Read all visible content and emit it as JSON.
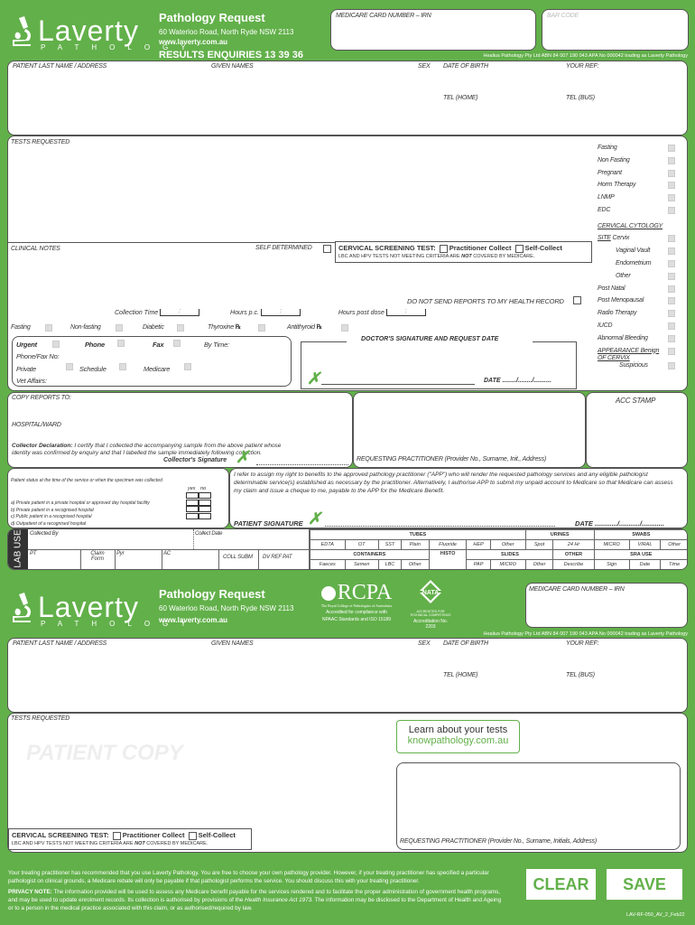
{
  "header": {
    "brand": "Laverty",
    "brand_sub": "PATHOLOGY",
    "title": "Pathology Request",
    "address": "60 Waterloo Road, North Ryde NSW 2113",
    "website": "www.laverty.com.au",
    "results": "RESULTS ENQUIRIES 13 39 36",
    "medicare_label": "MEDICARE CARD NUMBER – IRN",
    "barcode_label": "BAR CODE",
    "abn": "Healius Pathology Pty Ltd ABN 84 007 190 043 APA No 000042 trading as Laverty Pathology"
  },
  "patient": {
    "last_name": "PATIENT LAST NAME / ADDRESS",
    "given_names": "GIVEN NAMES",
    "sex": "SEX",
    "dob": "DATE OF BIRTH",
    "your_ref": "YOUR REF:",
    "tel_home": "TEL (HOME)",
    "tel_bus": "TEL (BUS)"
  },
  "tests": {
    "label": "TESTS REQUESTED",
    "side_items": [
      "Fasting",
      "Non Fasting",
      "Pregnant",
      "Horm Therapy",
      "LNMP",
      "EDC"
    ],
    "cytology_heading": "CERVICAL CYTOLOGY",
    "site_label": "SITE",
    "site_items": [
      "Cervix",
      "Vaginal Vault",
      "Endometrium",
      "Other"
    ],
    "other_items": [
      "Post Natal",
      "Post Menopausal",
      "Radio Therapy",
      "IUCD",
      "Abnormal Bleeding"
    ],
    "appearance": "APPEARANCE Benign",
    "appearance_sub": "OF CERVIX",
    "suspicious": "Suspicious"
  },
  "clinical": {
    "label": "CLINICAL NOTES",
    "self_determined": "SELF DETERMINED",
    "cst_label": "CERVICAL SCREENING TEST:",
    "practitioner_collect": "Practitioner Collect",
    "self_collect": "Self-Collect",
    "cst_note_pre": "LBC AND HPV TESTS NOT MEETING CRITERIA ARE",
    "cst_note_not": "NOT",
    "cst_note_post": "COVERED BY MEDICARE.",
    "no_health_record": "DO NOT SEND REPORTS TO MY HEALTH RECORD",
    "collection_time": "Collection Time",
    "hours_pc": "Hours p.c.",
    "hours_post_dose": "Hours post dose",
    "time_sep": ":",
    "fasting": "Fasting",
    "non_fasting": "Non-fasting",
    "diabetic": "Diabetic",
    "thyroxine": "Thyroxine",
    "antithyroid": "Antithyroid",
    "rx": "℞"
  },
  "urgent": {
    "urgent": "Urgent",
    "phone": "Phone",
    "fax": "Fax",
    "by_time": "By Time:",
    "phone_fax_no": "Phone/Fax No:",
    "private": "Private",
    "schedule": "Schedule",
    "medicare": "Medicare",
    "vet_affairs": "Vet Affairs:"
  },
  "doctor": {
    "heading": "DOCTOR'S SIGNATURE AND REQUEST DATE",
    "date": "DATE ......../......../.........."
  },
  "copy": {
    "copy_reports": "COPY REPORTS TO:",
    "hospital": "HOSPITAL/WARD",
    "decl_title": "Collector Declaration:",
    "decl_text": "I certify that I collected the accompanying sample from the above patient whose identity was confirmed by enquiry and that I labelled the sample immediately following collection.",
    "collector_sig": "Collector's Signature",
    "requesting": "REQUESTING PRACTITIONER (Provider No., Surname, Init., Address)",
    "acc_stamp": "ACC STAMP"
  },
  "status": {
    "intro": "Patient status at the time of the service or when the specimen was collected",
    "yes": "yes",
    "no": "no",
    "options": [
      "a) Private patient in a private hospital or approved day hospital facility",
      "b) Private patient in a recognised hospital",
      "c) Public patient in a recognised hospital",
      "d) Outpatient of a recognised hospital"
    ]
  },
  "assign": {
    "text": "I refer to assign my right to benefits to the approved pathology practitioner (\"APP\") who will render the requested pathology services and any eligible pathologist determinable service(s) established as necessary by the practitioner. Alternatively, I authorise APP to submit my unpaid account to Medicare so that Medicare can assess my claim and issue a cheque to me, payable to the APP for the Medicare Benefit.",
    "signature": "PATIENT SIGNATURE",
    "date": "DATE ............/.........../............"
  },
  "lab": {
    "label": "LAB USE",
    "collected_by": "Collected By",
    "collect_date": "Collect Date",
    "pt": "PT",
    "claim_form": "Claim Form",
    "pyr": "Pyr",
    "ac": "AC",
    "coll_subm": "COLL SUBM",
    "dv_ref_pat": "DV REF PAT",
    "tubes": "TUBES",
    "tube_items": [
      "EDTA",
      "OT",
      "SST",
      "Plain",
      "Fluoride",
      "HEP",
      "Other"
    ],
    "urines": "URINES",
    "urine_items": [
      "Spot",
      "24 Hr"
    ],
    "swabs": "SWABS",
    "swab_items": [
      "MICRO",
      "VIRAL",
      "Other"
    ],
    "containers": "CONTAINERS",
    "container_items": [
      "Faeces",
      "Semen",
      "LBC",
      "Other"
    ],
    "histo": "HISTO",
    "slides": "SLIDES",
    "slide_items": [
      "PAP",
      "MICRO",
      "Other"
    ],
    "other": "OTHER",
    "other_items": [
      "Describe"
    ],
    "sra": "SRA USE",
    "sra_items": [
      "Sign",
      "Date",
      "Time"
    ]
  },
  "copy2": {
    "rcpa": "RCPA",
    "rcpa_sub": "The Royal College of Pathologists of Australasia",
    "rcpa_acc1": "Accredited for compliance with",
    "rcpa_acc2": "NPAAC Standards and ISO 15189",
    "nata": "NATA",
    "nata_sub": "ACCREDITED FOR TECHNICAL COMPETENCE",
    "nata_acc": "Accreditation No. 2203",
    "patient_copy": "PATIENT COPY",
    "learn": "Learn about your tests",
    "learn_url": "knowpathology.com.au",
    "requesting": "REQUESTING PRACTITIONER (Provider No., Surname, Initials, Address)"
  },
  "footer": {
    "notice": "Your treating practitioner has recommended that you use Laverty Pathology. You are free to choose your own pathology provider. However, if your treating practitioner has specified a particular pathologist on clinical grounds, a Medicare rebate will only be payable if that pathologist performs the service. You should discuss this with your treating practitioner.",
    "privacy_title": "PRIVACY NOTE:",
    "privacy_pre": "The information provided will be used to assess any Medicare benefit payable for the services rendered and to facilitate the proper administration of government health programs, and may be used to update enrolment records. Its collection is authorised by provisions of the",
    "privacy_act": "Health Insurance Act 1973.",
    "privacy_post": "The information may be disclosed to the Department of Health and Ageing or to a person in the medical practice associated with this claim, or as authorised/required by law.",
    "clear": "CLEAR",
    "save": "SAVE",
    "form_code": "LAV-RF-050_AV_2_Feb22"
  }
}
